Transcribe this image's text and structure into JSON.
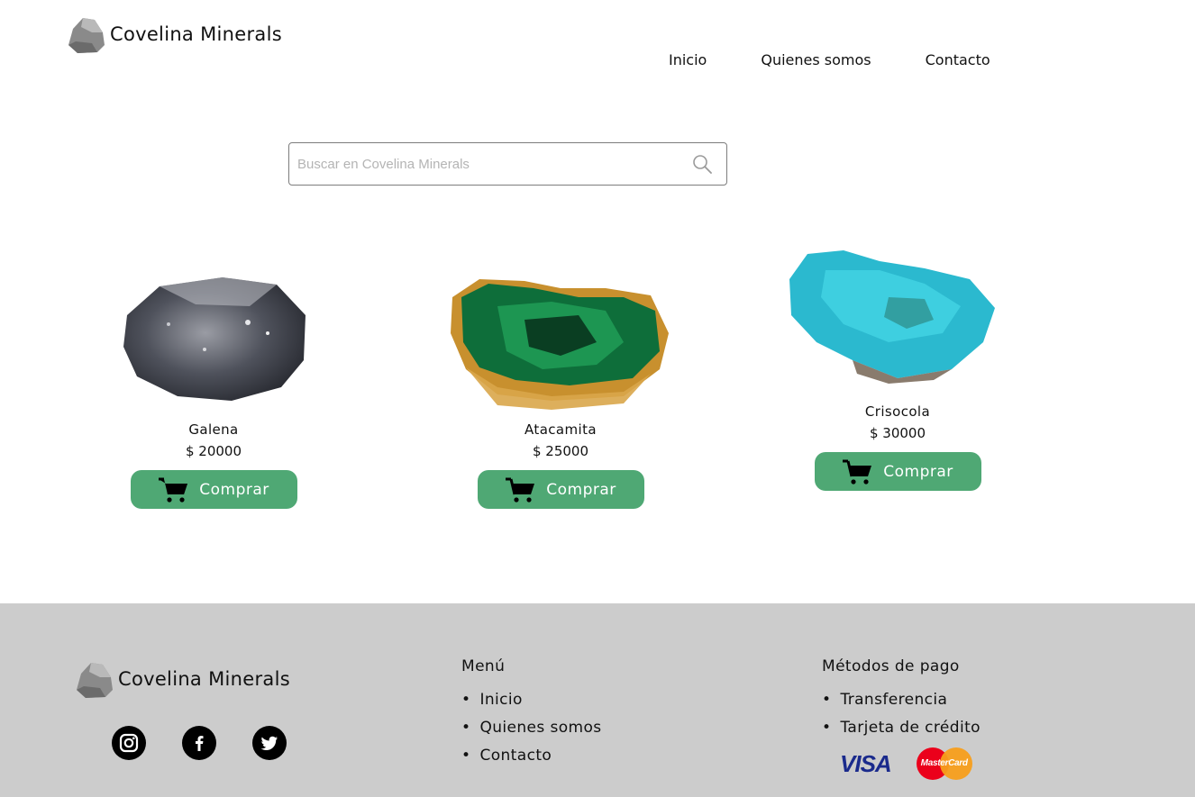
{
  "brand": {
    "name": "Covelina Minerals"
  },
  "nav": {
    "items": [
      "Inicio",
      "Quienes somos",
      "Contacto"
    ]
  },
  "search": {
    "placeholder": "Buscar en Covelina Minerals",
    "value": ""
  },
  "products": [
    {
      "name": "Galena",
      "price": "$ 20000",
      "button_label": "Comprar",
      "image": "galena-mineral"
    },
    {
      "name": "Atacamita",
      "price": "$ 25000",
      "button_label": "Comprar",
      "image": "atacamita-mineral"
    },
    {
      "name": "Crisocola",
      "price": "$ 30000",
      "button_label": "Comprar",
      "image": "crisocola-mineral"
    }
  ],
  "footer": {
    "brand": "Covelina Minerals",
    "socials": [
      "instagram-icon",
      "facebook-icon",
      "twitter-icon"
    ],
    "menu": {
      "title": "Menú",
      "items": [
        "Inicio",
        "Quienes somos",
        "Contacto"
      ]
    },
    "payments": {
      "title": "Métodos de pago",
      "items": [
        "Transferencia",
        "Tarjeta de crédito"
      ],
      "cards": {
        "visa": "VISA",
        "mastercard": "MasterCard"
      }
    }
  },
  "colors": {
    "button": "#4fa874",
    "footer_bg": "#cccccc"
  }
}
